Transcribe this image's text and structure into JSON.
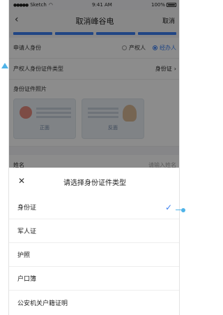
{
  "status": {
    "carrier": "Sketch",
    "time": "9:41 AM",
    "battery": "100%"
  },
  "nav": {
    "back": "‹",
    "title": "取消峰谷电",
    "cancel": "取消"
  },
  "form": {
    "applicant_label": "申请人身份",
    "option_owner": "产权人",
    "option_agent": "经办人",
    "id_type_label": "产权人身份证件类型",
    "id_type_value": "身份证",
    "photo_label": "身份证件照片",
    "front_tag": "正面",
    "back_tag": "反面",
    "name_label": "姓名",
    "name_placeholder": "请输入姓名"
  },
  "sheet": {
    "close": "✕",
    "title": "请选择身份证件类型",
    "options": [
      "身份证",
      "军人证",
      "护照",
      "户口簿",
      "公安机关户籍证明"
    ],
    "selected_index": 0
  },
  "colors": {
    "accent": "#3b7ff0",
    "marker": "#4fb3e8"
  }
}
